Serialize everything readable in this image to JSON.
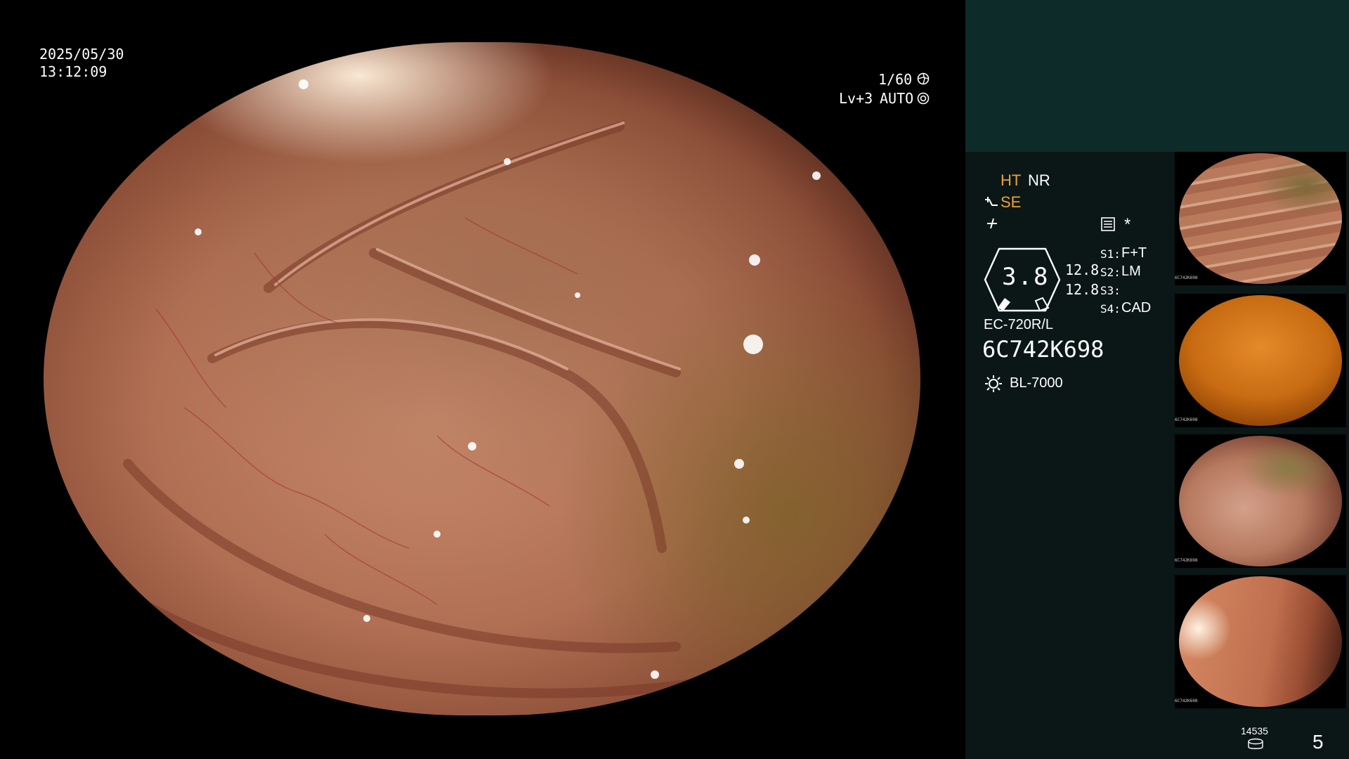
{
  "datetime": {
    "date": "2025/05/30",
    "time": "13:12:09"
  },
  "exposure": {
    "shutter": "1/60",
    "level": "Lv+3",
    "mode": "AUTO"
  },
  "settings": {
    "ht": "HT",
    "nr": "NR",
    "se": "SE",
    "zoom_value": "3.8",
    "val_a": "12.8",
    "val_b": "12.8",
    "s1": {
      "key": "S1:",
      "value": "F+T"
    },
    "s2": {
      "key": "S2:",
      "value": "LM"
    },
    "s3": {
      "key": "S3:",
      "value": ""
    },
    "s4": {
      "key": "S4:",
      "value": "CAD"
    }
  },
  "device": {
    "scope_model": "EC-720R/L",
    "serial": "6C742K698",
    "light_source": "BL-7000"
  },
  "counter": {
    "storage": "14535",
    "image_count": "5"
  },
  "thumbnails": [
    {
      "tiny_label": "6C742K698",
      "tone": "folds"
    },
    {
      "tiny_label": "6C742K698",
      "tone": "orange"
    },
    {
      "tiny_label": "6C742K698",
      "tone": "folds"
    },
    {
      "tiny_label": "6C742K698",
      "tone": "lumen"
    }
  ],
  "colors": {
    "accent_orange": "#f0a030",
    "panel_top": "#0d2b28",
    "panel_bottom": "#0a1716"
  },
  "icons": [
    "shutter-icon",
    "auto-iris-icon",
    "enhance-icon",
    "freeze-icon",
    "memo-icon",
    "asterisk-icon",
    "light-source-icon",
    "storage-icon"
  ]
}
